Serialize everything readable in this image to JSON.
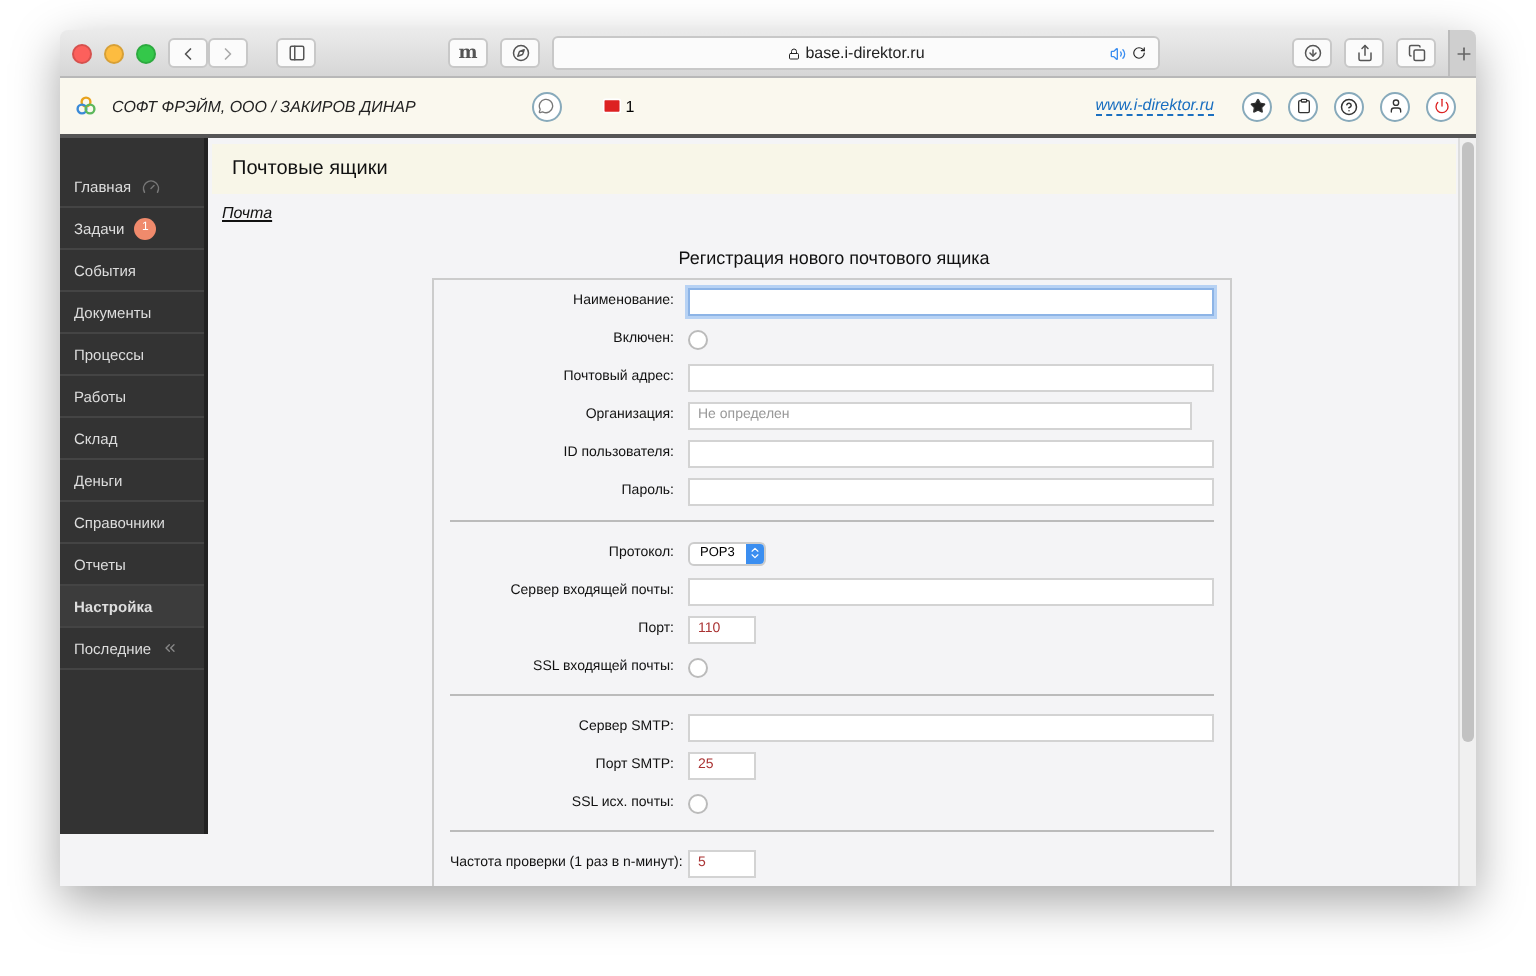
{
  "browser": {
    "url": "base.i-direktor.ru",
    "extension_label": "m"
  },
  "header": {
    "company": "СОФТ ФРЭЙМ, ООО / ЗАКИРОВ ДИНАР",
    "mail_count": "1",
    "link": "www.i-direktor.ru"
  },
  "sidebar": {
    "items": [
      {
        "label": "Главная",
        "selected": false,
        "kind": "gauge"
      },
      {
        "label": "Задачи",
        "selected": false,
        "kind": "badge",
        "badge": "1"
      },
      {
        "label": "События",
        "selected": false,
        "kind": "plain"
      },
      {
        "label": "Документы",
        "selected": false,
        "kind": "plain"
      },
      {
        "label": "Процессы",
        "selected": false,
        "kind": "plain"
      },
      {
        "label": "Работы",
        "selected": false,
        "kind": "plain"
      },
      {
        "label": "Склад",
        "selected": false,
        "kind": "plain"
      },
      {
        "label": "Деньги",
        "selected": false,
        "kind": "plain"
      },
      {
        "label": "Справочники",
        "selected": false,
        "kind": "plain"
      },
      {
        "label": "Отчеты",
        "selected": false,
        "kind": "plain"
      },
      {
        "label": "Настройка",
        "selected": true,
        "kind": "plain"
      },
      {
        "label": "Последние",
        "selected": false,
        "kind": "collapse"
      }
    ]
  },
  "page": {
    "title": "Почтовые ящики",
    "breadcrumb": "Почта"
  },
  "form": {
    "title": "Регистрация нового почтового ящика",
    "sections": [
      {
        "rows": [
          {
            "label": "Наименование:",
            "kind": "text",
            "focused": true
          },
          {
            "label": "Включен:",
            "kind": "checkbox",
            "checked": false
          },
          {
            "label": "Почтовый адрес:",
            "kind": "text",
            "focused": false
          },
          {
            "label": "Организация:",
            "kind": "lookup",
            "placeholder": "Не определен"
          },
          {
            "label": "ID пользователя:",
            "kind": "text",
            "focused": false
          },
          {
            "label": "Пароль:",
            "kind": "text",
            "focused": false
          }
        ]
      },
      {
        "rows": [
          {
            "label": "Протокол:",
            "kind": "select",
            "value": "POP3"
          },
          {
            "label": "Сервер входящей почты:",
            "kind": "text",
            "focused": false
          },
          {
            "label": "Порт:",
            "kind": "short",
            "value": "110"
          },
          {
            "label": "SSL входящей почты:",
            "kind": "checkbox",
            "checked": false
          }
        ]
      },
      {
        "rows": [
          {
            "label": "Сервер SMTP:",
            "kind": "text",
            "focused": false
          },
          {
            "label": "Порт SMTP:",
            "kind": "short",
            "value": "25"
          },
          {
            "label": "SSL исх. почты:",
            "kind": "checkbox",
            "checked": false
          }
        ]
      },
      {
        "rows": [
          {
            "label": "Частота проверки (1 раз в n-минут):",
            "kind": "short",
            "value": "5"
          }
        ]
      }
    ]
  }
}
